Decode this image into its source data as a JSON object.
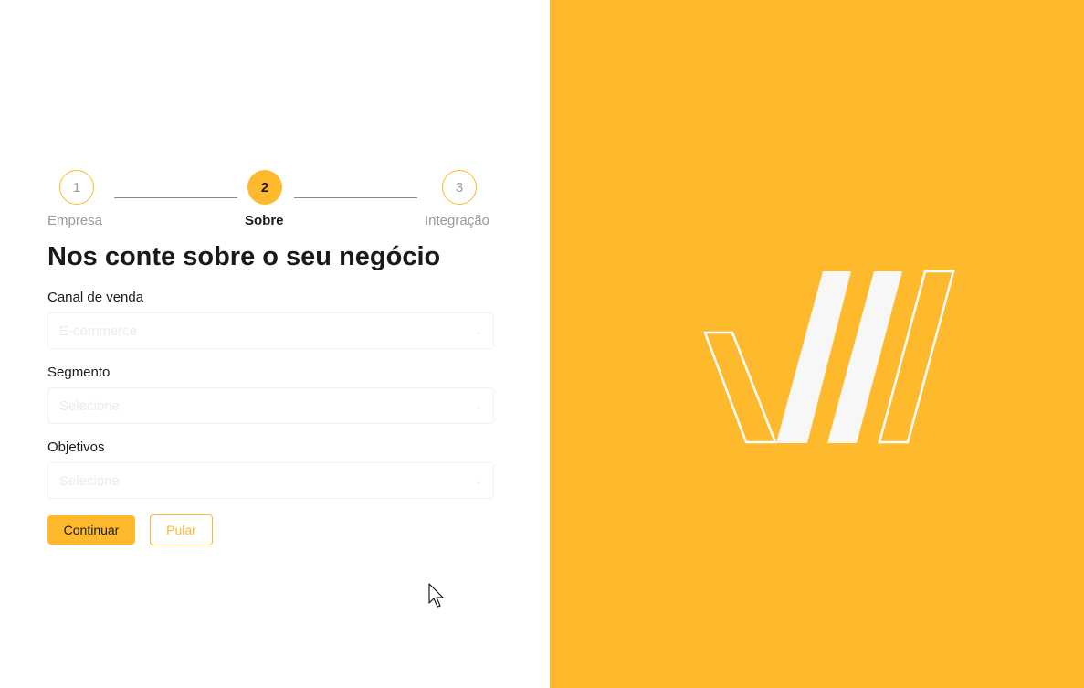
{
  "stepper": {
    "steps": [
      {
        "number": "1",
        "label": "Empresa",
        "state": "inactive"
      },
      {
        "number": "2",
        "label": "Sobre",
        "state": "active"
      },
      {
        "number": "3",
        "label": "Integração",
        "state": "inactive"
      }
    ]
  },
  "form": {
    "title": "Nos conte sobre o seu negócio",
    "fields": [
      {
        "label": "Canal de venda",
        "value": "E-commerce"
      },
      {
        "label": "Segmento",
        "value": "Selecione"
      },
      {
        "label": "Objetivos",
        "value": "Selecione"
      }
    ],
    "continue_label": "Continuar",
    "skip_label": "Pular"
  },
  "colors": {
    "accent": "#feb92d",
    "panel_background": "#feb92d",
    "logo_fill": "#f7f7f7"
  }
}
